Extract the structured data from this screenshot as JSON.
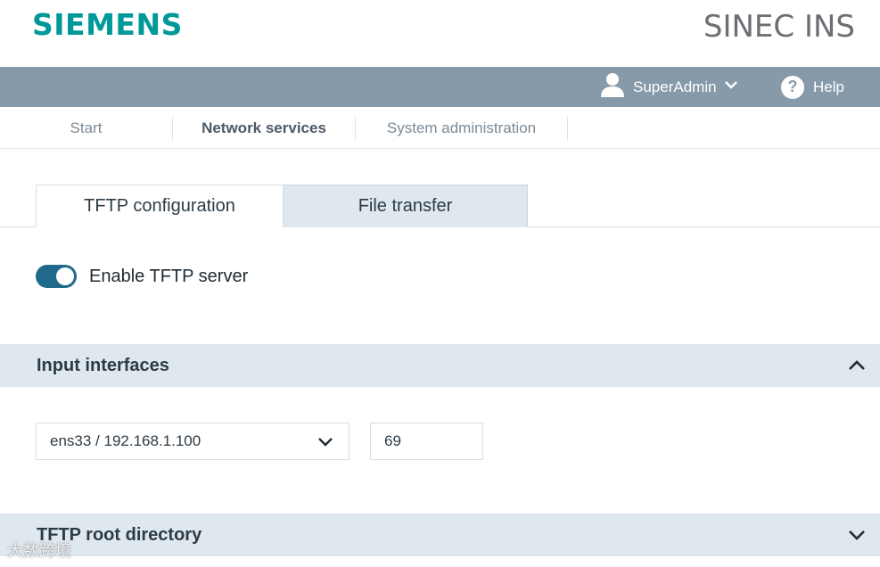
{
  "header": {
    "logo": "SIEMENS",
    "product": "SINEC INS"
  },
  "userbar": {
    "user_label": "SuperAdmin",
    "help_label": "Help",
    "help_glyph": "?"
  },
  "nav": {
    "items": [
      {
        "label": "Start",
        "active": false
      },
      {
        "label": "Network services",
        "active": true
      },
      {
        "label": "System administration",
        "active": false
      }
    ]
  },
  "tabs": [
    {
      "label": "TFTP configuration",
      "active": true
    },
    {
      "label": "File transfer",
      "active": false
    }
  ],
  "toggle": {
    "label": "Enable TFTP server",
    "on": true
  },
  "sections": {
    "input_interfaces": {
      "title": "Input interfaces",
      "expanded": true
    },
    "root_directory": {
      "title": "TFTP root directory",
      "expanded": false
    }
  },
  "interface": {
    "selected": "ens33 / 192.168.1.100",
    "port": "69"
  },
  "watermark": "大数跨境",
  "colors": {
    "brand": "#009999",
    "userbar": "#879aaa",
    "toggle_on": "#1f6a8a",
    "section_bg": "#dfe7ef"
  }
}
